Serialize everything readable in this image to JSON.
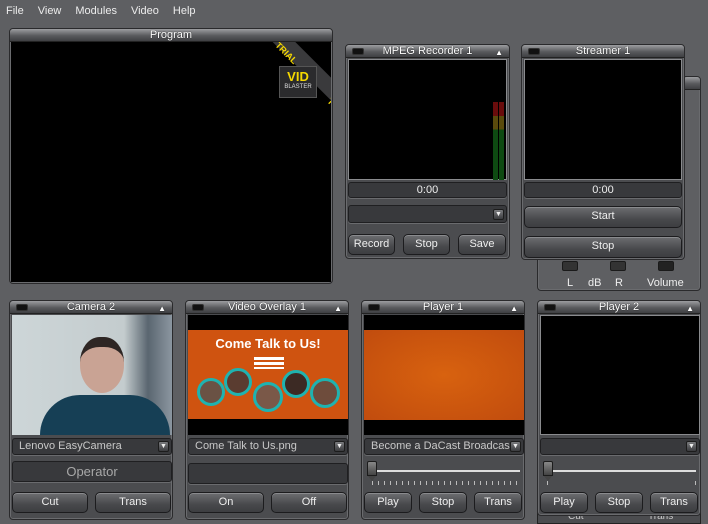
{
  "menu": [
    "File",
    "View",
    "Modules",
    "Video",
    "Help"
  ],
  "program": {
    "title": "Program",
    "watermark": {
      "brand_top": "VID",
      "brand_bottom": "BLASTER",
      "ribbon": "TRIAL",
      "colors": {
        "ribbon_text": "#f5d800",
        "brand_text": "#f5d800"
      }
    }
  },
  "mpeg_recorder": {
    "title": "MPEG Recorder 1",
    "time": "0:00",
    "format_select": "",
    "buttons": {
      "record": "Record",
      "stop": "Stop",
      "save": "Save"
    }
  },
  "streamer": {
    "title": "Streamer 1",
    "time": "0:00",
    "buttons": {
      "start": "Start",
      "stop": "Stop"
    }
  },
  "audio_mixer": {
    "labels": {
      "left": "L",
      "db": "dB",
      "right": "R",
      "volume": "Volume"
    }
  },
  "camera": {
    "title": "Camera 2",
    "device_select": "Lenovo EasyCamera",
    "operator_field": "Operator",
    "buttons": {
      "cut": "Cut",
      "trans": "Trans"
    }
  },
  "video_overlay": {
    "title": "Video Overlay 1",
    "preview_heading": "Come Talk to Us!",
    "file_select": "Come Talk to Us.png",
    "text_field": "",
    "buttons": {
      "on": "On",
      "off": "Off"
    },
    "colors": {
      "background": "#cf5310",
      "ring": "#1fb3b0"
    }
  },
  "player1": {
    "title": "Player 1",
    "file_select": "Become a DaCast Broadcas",
    "position_percent": 0,
    "buttons": {
      "play": "Play",
      "stop": "Stop",
      "trans": "Trans"
    },
    "colors": {
      "preview": "#d05510"
    }
  },
  "player2": {
    "title": "Player 2",
    "file_select": "",
    "position_percent": 0,
    "buttons": {
      "play": "Play",
      "stop": "Stop",
      "trans": "Trans"
    }
  },
  "hidden_panel_buttons": {
    "cut": "Cut",
    "trans": "Trans"
  }
}
